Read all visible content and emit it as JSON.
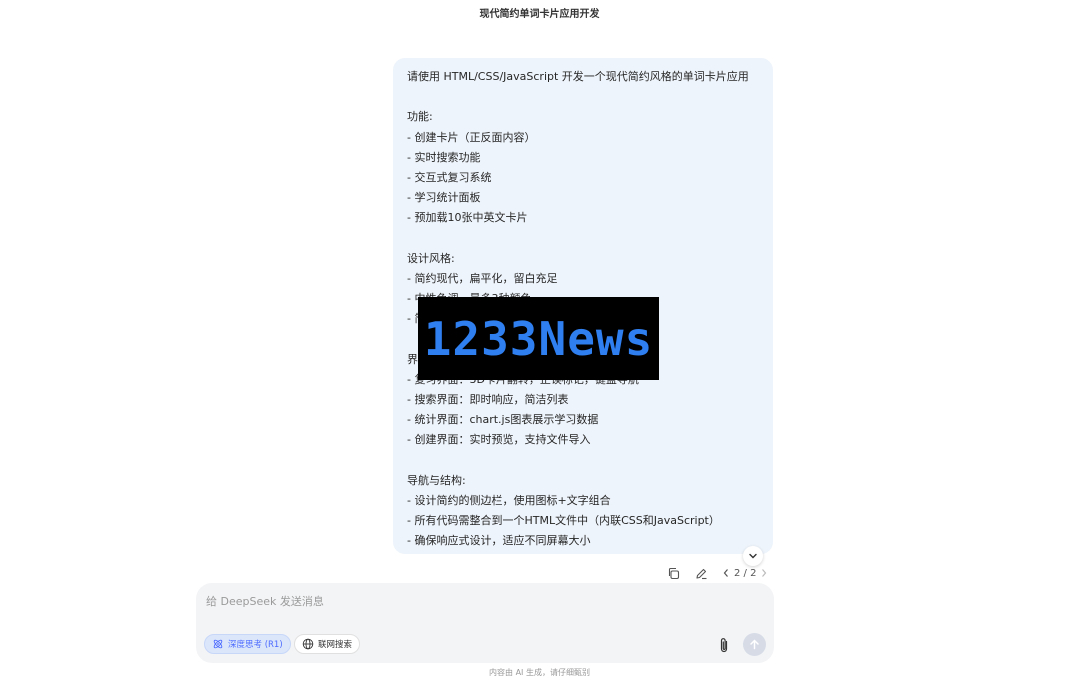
{
  "header": {
    "title": "现代简约单词卡片应用开发"
  },
  "message": {
    "lines": [
      "请使用 HTML/CSS/JavaScript 开发一个现代简约风格的单词卡片应用",
      "",
      "功能:",
      "- 创建卡片（正反面内容）",
      "- 实时搜索功能",
      "- 交互式复习系统",
      "- 学习统计面板",
      "- 预加载10张中英文卡片",
      "",
      "设计风格:",
      "- 简约现代，扁平化，留白充足",
      "- 中性色调，最多3种颜色",
      "- 简",
      "",
      "界",
      "- 复习界面：3D卡片翻转，正误标记，键盘导航",
      "- 搜索界面：即时响应，简洁列表",
      "- 统计界面：chart.js图表展示学习数据",
      "- 创建界面：实时预览，支持文件导入",
      "",
      "导航与结构:",
      "- 设计简约的侧边栏，使用图标+文字组合",
      "- 所有代码需整合到一个HTML文件中（内联CSS和JavaScript）",
      "- 确保响应式设计，适应不同屏幕大小"
    ]
  },
  "actions": {
    "pager": "2 / 2"
  },
  "composer": {
    "placeholder": "给 DeepSeek 发送消息",
    "deep_think_label": "深度思考 (R1)",
    "web_search_label": "联网搜索"
  },
  "footer": {
    "disclaimer": "内容由 AI 生成，请仔细甄别"
  },
  "watermark": {
    "text": "1233News"
  },
  "colors": {
    "accent": "#4d6bfe",
    "bubble": "#eef4fb",
    "input_bg": "#f3f4f6"
  }
}
